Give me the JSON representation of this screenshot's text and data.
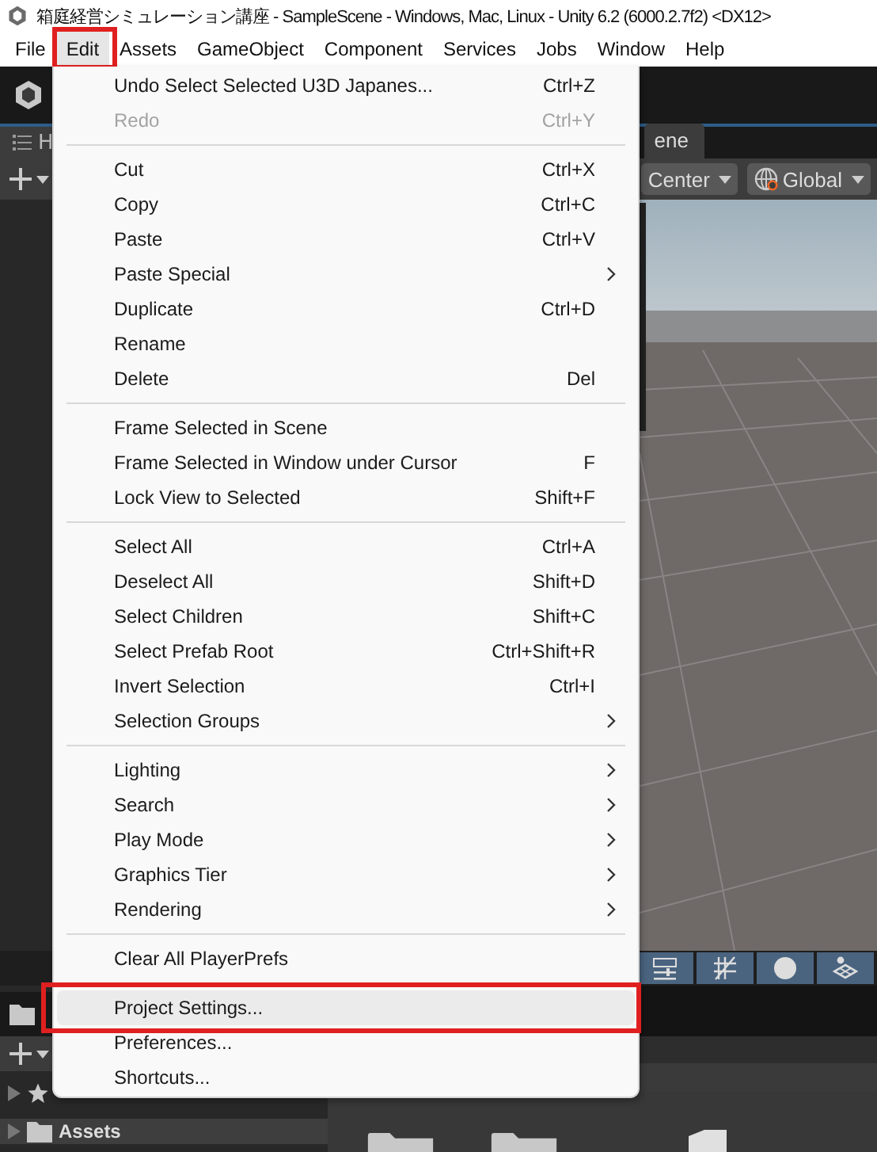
{
  "window": {
    "title": "箱庭経営シミュレーション講座 - SampleScene - Windows, Mac, Linux - Unity 6.2 (6000.2.7f2) <DX12>"
  },
  "menubar": [
    {
      "label": "File",
      "selected": false,
      "highlighted": false
    },
    {
      "label": "Edit",
      "selected": true,
      "highlighted": true
    },
    {
      "label": "Assets",
      "selected": false,
      "highlighted": false
    },
    {
      "label": "GameObject",
      "selected": false,
      "highlighted": false
    },
    {
      "label": "Component",
      "selected": false,
      "highlighted": false
    },
    {
      "label": "Services",
      "selected": false,
      "highlighted": false
    },
    {
      "label": "Jobs",
      "selected": false,
      "highlighted": false
    },
    {
      "label": "Window",
      "selected": false,
      "highlighted": false
    },
    {
      "label": "Help",
      "selected": false,
      "highlighted": false
    }
  ],
  "editor": {
    "hierarchy_tab": "H",
    "scene_tab": "ene",
    "pivot_dropdown": "Center",
    "space_dropdown": "Global",
    "scene_toggles": [
      {
        "kind": "sliders",
        "on": true
      },
      {
        "kind": "grid",
        "on": true
      },
      {
        "kind": "sphere",
        "on": true
      },
      {
        "kind": "layers",
        "on": true
      }
    ],
    "project_tree": [
      {
        "label": "Assets",
        "selected": true
      }
    ]
  },
  "menu": {
    "items": [
      {
        "kind": "item",
        "label": "Undo Select Selected U3D Japanes...",
        "shortcut": "Ctrl+Z",
        "disabled": false,
        "submenu": false,
        "selected": false,
        "highlighted": false
      },
      {
        "kind": "item",
        "label": "Redo",
        "shortcut": "Ctrl+Y",
        "disabled": true,
        "submenu": false,
        "selected": false,
        "highlighted": false
      },
      {
        "kind": "separator"
      },
      {
        "kind": "item",
        "label": "Cut",
        "shortcut": "Ctrl+X",
        "disabled": false,
        "submenu": false,
        "selected": false,
        "highlighted": false
      },
      {
        "kind": "item",
        "label": "Copy",
        "shortcut": "Ctrl+C",
        "disabled": false,
        "submenu": false,
        "selected": false,
        "highlighted": false
      },
      {
        "kind": "item",
        "label": "Paste",
        "shortcut": "Ctrl+V",
        "disabled": false,
        "submenu": false,
        "selected": false,
        "highlighted": false
      },
      {
        "kind": "item",
        "label": "Paste Special",
        "disabled": false,
        "submenu": true,
        "selected": false,
        "highlighted": false
      },
      {
        "kind": "item",
        "label": "Duplicate",
        "shortcut": "Ctrl+D",
        "disabled": false,
        "submenu": false,
        "selected": false,
        "highlighted": false
      },
      {
        "kind": "item",
        "label": "Rename",
        "disabled": false,
        "submenu": false,
        "selected": false,
        "highlighted": false
      },
      {
        "kind": "item",
        "label": "Delete",
        "shortcut": "Del",
        "disabled": false,
        "submenu": false,
        "selected": false,
        "highlighted": false
      },
      {
        "kind": "separator"
      },
      {
        "kind": "item",
        "label": "Frame Selected in Scene",
        "disabled": false,
        "submenu": false,
        "selected": false,
        "highlighted": false
      },
      {
        "kind": "item",
        "label": "Frame Selected in Window under Cursor",
        "shortcut": "F",
        "disabled": false,
        "submenu": false,
        "selected": false,
        "highlighted": false
      },
      {
        "kind": "item",
        "label": "Lock View to Selected",
        "shortcut": "Shift+F",
        "disabled": false,
        "submenu": false,
        "selected": false,
        "highlighted": false
      },
      {
        "kind": "separator"
      },
      {
        "kind": "item",
        "label": "Select All",
        "shortcut": "Ctrl+A",
        "disabled": false,
        "submenu": false,
        "selected": false,
        "highlighted": false
      },
      {
        "kind": "item",
        "label": "Deselect All",
        "shortcut": "Shift+D",
        "disabled": false,
        "submenu": false,
        "selected": false,
        "highlighted": false
      },
      {
        "kind": "item",
        "label": "Select Children",
        "shortcut": "Shift+C",
        "disabled": false,
        "submenu": false,
        "selected": false,
        "highlighted": false
      },
      {
        "kind": "item",
        "label": "Select Prefab Root",
        "shortcut": "Ctrl+Shift+R",
        "disabled": false,
        "submenu": false,
        "selected": false,
        "highlighted": false
      },
      {
        "kind": "item",
        "label": "Invert Selection",
        "shortcut": "Ctrl+I",
        "disabled": false,
        "submenu": false,
        "selected": false,
        "highlighted": false
      },
      {
        "kind": "item",
        "label": "Selection Groups",
        "disabled": false,
        "submenu": true,
        "selected": false,
        "highlighted": false
      },
      {
        "kind": "separator"
      },
      {
        "kind": "item",
        "label": "Lighting",
        "disabled": false,
        "submenu": true,
        "selected": false,
        "highlighted": false
      },
      {
        "kind": "item",
        "label": "Search",
        "disabled": false,
        "submenu": true,
        "selected": false,
        "highlighted": false
      },
      {
        "kind": "item",
        "label": "Play Mode",
        "disabled": false,
        "submenu": true,
        "selected": false,
        "highlighted": false
      },
      {
        "kind": "item",
        "label": "Graphics Tier",
        "disabled": false,
        "submenu": true,
        "selected": false,
        "highlighted": false
      },
      {
        "kind": "item",
        "label": "Rendering",
        "disabled": false,
        "submenu": true,
        "selected": false,
        "highlighted": false
      },
      {
        "kind": "separator"
      },
      {
        "kind": "item",
        "label": "Clear All PlayerPrefs",
        "disabled": false,
        "submenu": false,
        "selected": false,
        "highlighted": false
      },
      {
        "kind": "separator"
      },
      {
        "kind": "item",
        "label": "Project Settings...",
        "disabled": false,
        "submenu": false,
        "selected": true,
        "highlighted": true
      },
      {
        "kind": "item",
        "label": "Preferences...",
        "disabled": false,
        "submenu": false,
        "selected": false,
        "highlighted": false
      },
      {
        "kind": "item",
        "label": "Shortcuts...",
        "disabled": false,
        "submenu": false,
        "selected": false,
        "highlighted": false
      }
    ]
  }
}
